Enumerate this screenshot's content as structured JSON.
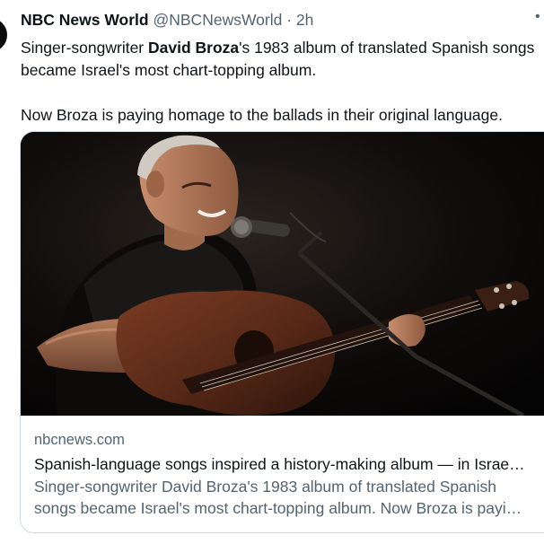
{
  "tweet": {
    "author_name": "NBC News World",
    "author_handle": "@NBCNewsWorld",
    "separator": " · ",
    "time": "2h",
    "text_line1_before": "Singer-songwriter ",
    "text_line1_bold": "David Broza",
    "text_line1_after": "'s 1983 album of translated Spanish songs",
    "text_line2": "became Israel's most chart-topping album.",
    "text_para2": "Now Broza is paying homage to the ballads in their original language.",
    "more_icon": "more-options-icon"
  },
  "card": {
    "domain": "nbcnews.com",
    "title": "Spanish-language songs inspired a history-making album — in Israe…",
    "description_line1": "Singer-songwriter David Broza's 1983 album of translated Spanish",
    "description_line2": "songs became Israel's most chart-topping album. Now Broza is payi…",
    "image_subject": "guitarist-performing-photo"
  },
  "colors": {
    "text_primary": "#0f1419",
    "text_secondary": "#536471",
    "border": "#cfd9de",
    "image_background": "#080706"
  }
}
